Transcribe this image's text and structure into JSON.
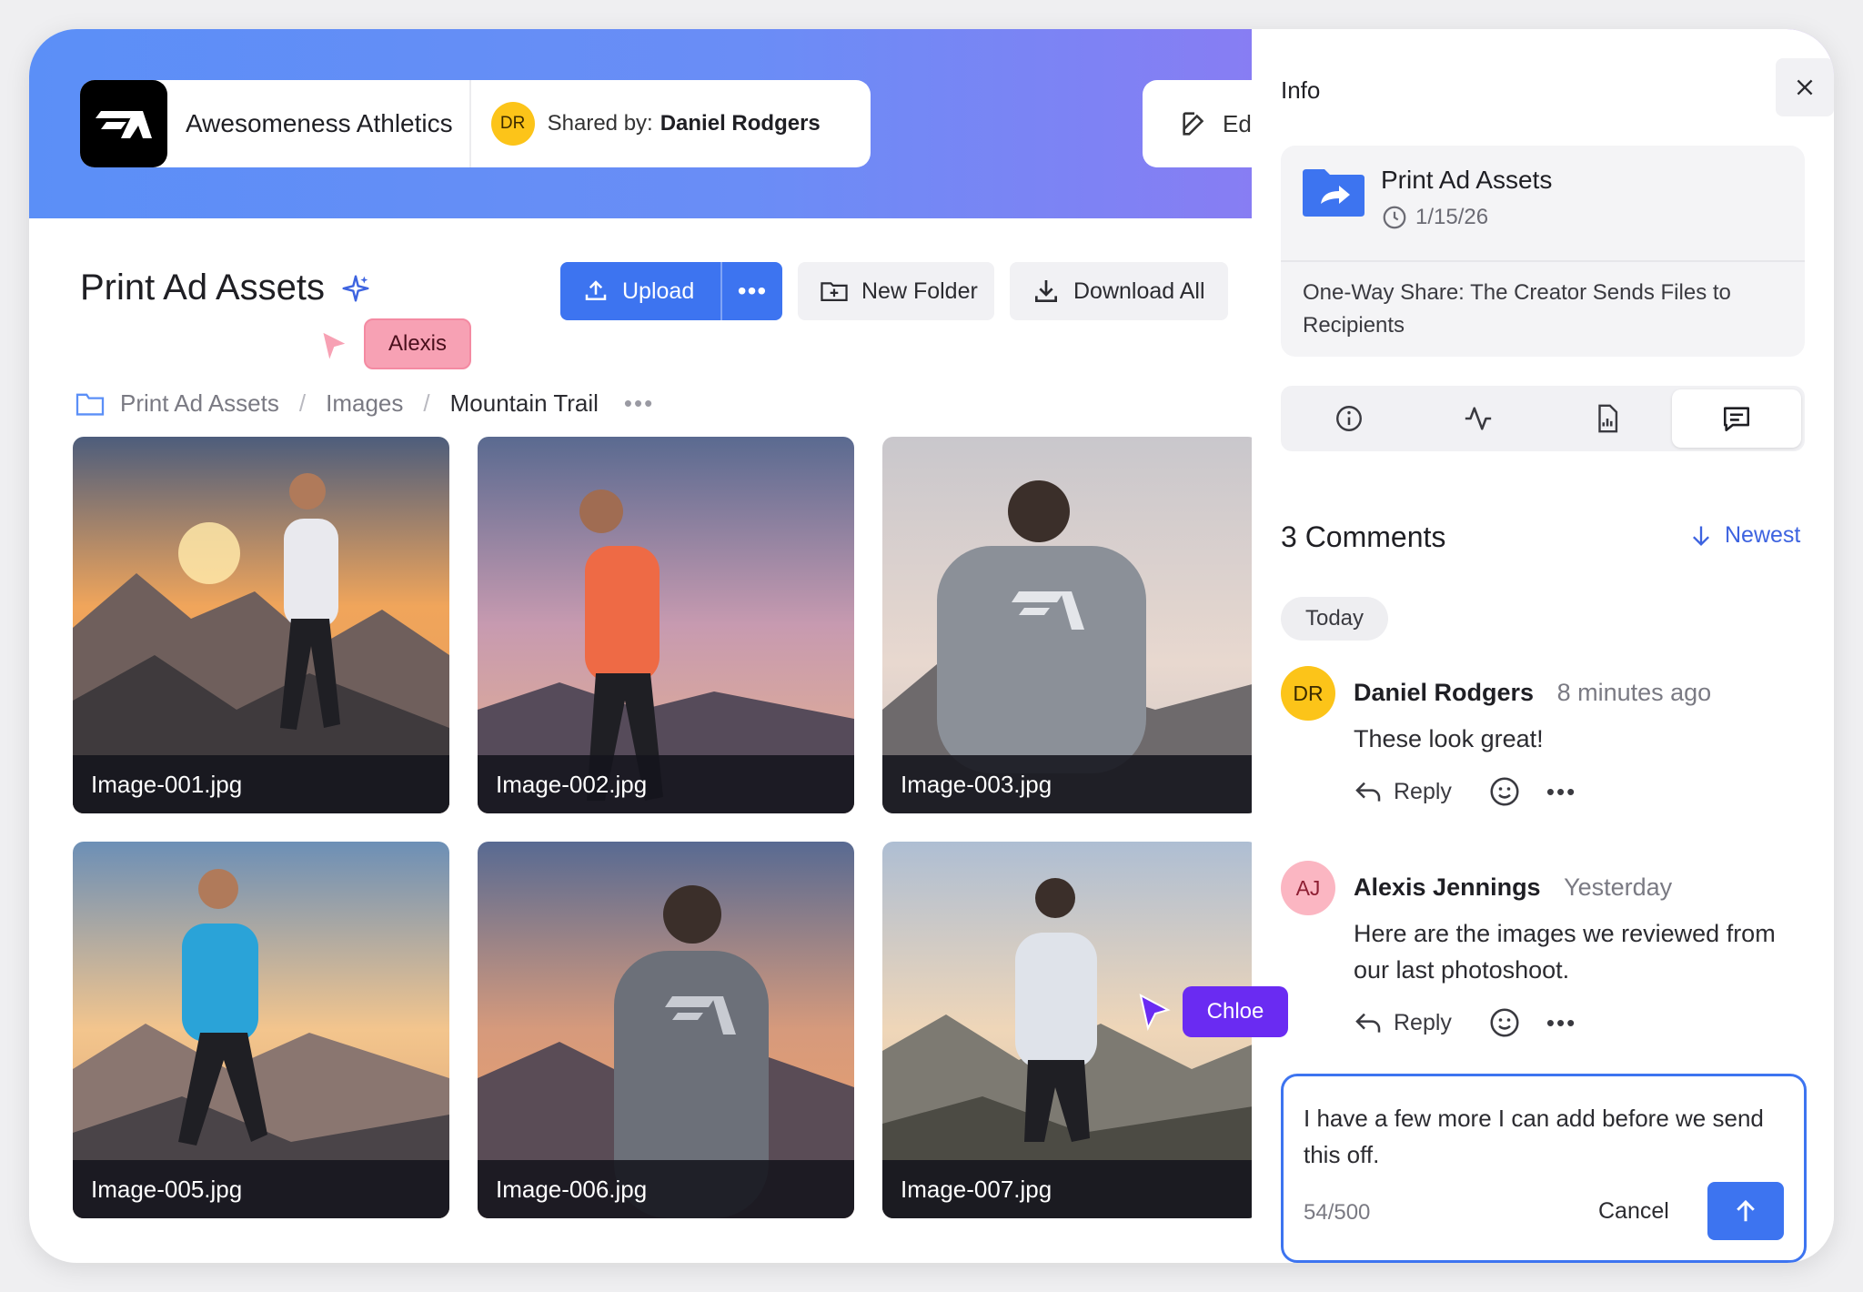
{
  "header": {
    "brand_name": "Awesomeness Athletics",
    "shared_label": "Shared by:",
    "shared_by": "Daniel Rodgers",
    "shared_initials": "DR",
    "edit_label": "Edi"
  },
  "toolbar": {
    "page_title": "Print Ad Assets",
    "upload_label": "Upload",
    "more_label": "•••",
    "new_folder_label": "New Folder",
    "download_all_label": "Download All"
  },
  "presence": [
    {
      "name": "Alexis",
      "color": "#f7a1b4"
    },
    {
      "name": "Chloe",
      "color": "#6a2bf2"
    }
  ],
  "breadcrumb": {
    "items": [
      "Print Ad Assets",
      "Images",
      "Mountain Trail"
    ],
    "separator": "/",
    "overflow": "•••"
  },
  "images": [
    {
      "name": "Image-001.jpg",
      "jacket": "#e9e9ee",
      "sky": "warm-sunset"
    },
    {
      "name": "Image-002.jpg",
      "jacket": "#ee6a45",
      "sky": "dusk-purple"
    },
    {
      "name": "Image-003.jpg",
      "jacket": "#8b9098",
      "sky": "pale-morning"
    },
    {
      "name": "Image-005.jpg",
      "jacket": "#2aa3d8",
      "sky": "golden-hour"
    },
    {
      "name": "Image-006.jpg",
      "jacket": "#6c7079",
      "sky": "orange-dusk"
    },
    {
      "name": "Image-007.jpg",
      "jacket": "#dfe3ea",
      "sky": "soft-morning"
    }
  ],
  "info_panel": {
    "title": "Info",
    "file_name": "Print Ad Assets",
    "file_date": "1/15/26",
    "file_description": "One-Way Share: The Creator Sends Files to Recipients",
    "tabs": [
      "info-icon",
      "activity-icon",
      "report-icon",
      "comments-icon"
    ],
    "comments_heading": "3 Comments",
    "sort_label": "Newest",
    "day_label": "Today",
    "reply_label": "Reply",
    "more_label": "•••",
    "comments": [
      {
        "initials": "DR",
        "name": "Daniel Rodgers",
        "time": "8 minutes ago",
        "text": "These look great!"
      },
      {
        "initials": "AJ",
        "name": "Alexis Jennings",
        "time": "Yesterday",
        "text": "Here are the images we reviewed from our last photoshoot."
      }
    ],
    "composer": {
      "text": "I have a few more I can add before we send this off.",
      "count": "54/500",
      "cancel_label": "Cancel"
    }
  },
  "colors": {
    "accent": "#3d74f0",
    "hero_start": "#5b8ff7",
    "hero_end": "#a070f0",
    "avatar_dr": "#fcc419",
    "avatar_aj": "#fbb6c2"
  }
}
